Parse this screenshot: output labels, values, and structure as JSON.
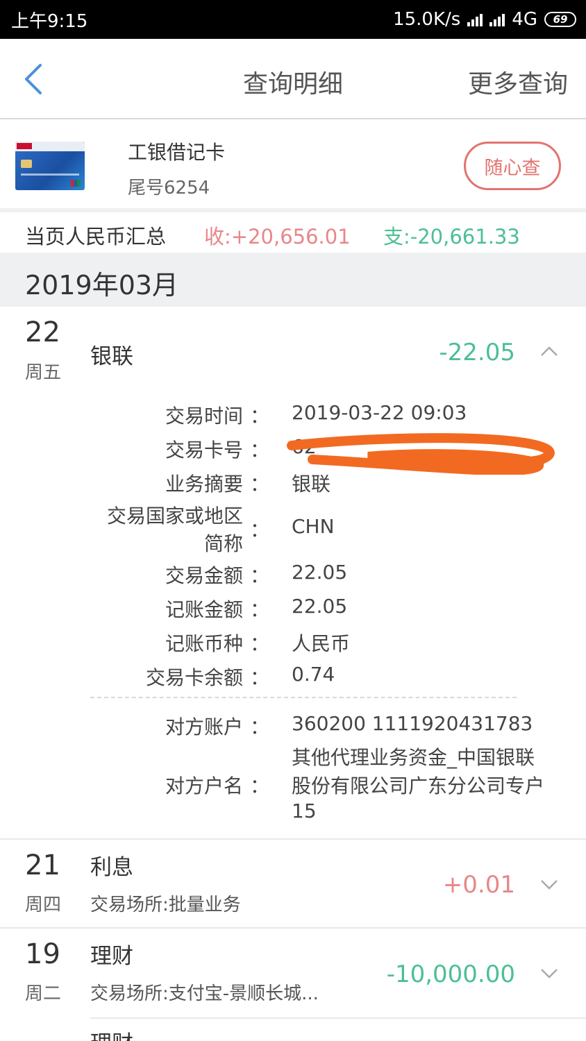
{
  "status_bar": {
    "time": "上午9:15",
    "speed": "15.0K/s",
    "network": "4G",
    "battery": "69"
  },
  "nav": {
    "title": "查询明细",
    "more": "更多查询"
  },
  "card": {
    "name": "工银借记卡",
    "tail": "尾号6254",
    "query_button": "随心查"
  },
  "summary": {
    "label": "当页人民币汇总",
    "income": "收:+20,656.01",
    "expense": "支:-20,661.33"
  },
  "month": "2019年03月",
  "transactions": [
    {
      "day": "22",
      "weekday": "周五",
      "title": "银联",
      "amount": "-22.05",
      "details": [
        {
          "label": "交易时间",
          "value": "2019-03-22 09:03"
        },
        {
          "label": "交易卡号",
          "value": "62"
        },
        {
          "label": "业务摘要",
          "value": "银联"
        },
        {
          "label_line1": "交易国家或地区",
          "label_line2": "简称",
          "value": "CHN"
        },
        {
          "label": "交易金额",
          "value": "22.05"
        },
        {
          "label": "记账金额",
          "value": "22.05"
        },
        {
          "label": "记账币种",
          "value": "人民币"
        },
        {
          "label": "交易卡余额",
          "value": "0.74"
        },
        {
          "label": "对方账户",
          "value": "360200 1111920431783"
        },
        {
          "label": "对方户名",
          "value_line1": "其他代理业务资金_中国银联",
          "value_line2": "股份有限公司广东分公司专户",
          "value_line3": "15"
        }
      ]
    },
    {
      "day": "21",
      "weekday": "周四",
      "title": "利息",
      "subtitle": "交易场所:批量业务",
      "amount": "+0.01"
    },
    {
      "day": "19",
      "weekday": "周二",
      "title": "理财",
      "subtitle": "交易场所:支付宝-景顺长城...",
      "amount": "-10,000.00"
    },
    {
      "title": "理财"
    }
  ],
  "colors": {
    "income": "#e8868a",
    "expense": "#4cbf94",
    "accent_button": "#e2736f",
    "redaction": "#f26a22"
  },
  "colon": "："
}
